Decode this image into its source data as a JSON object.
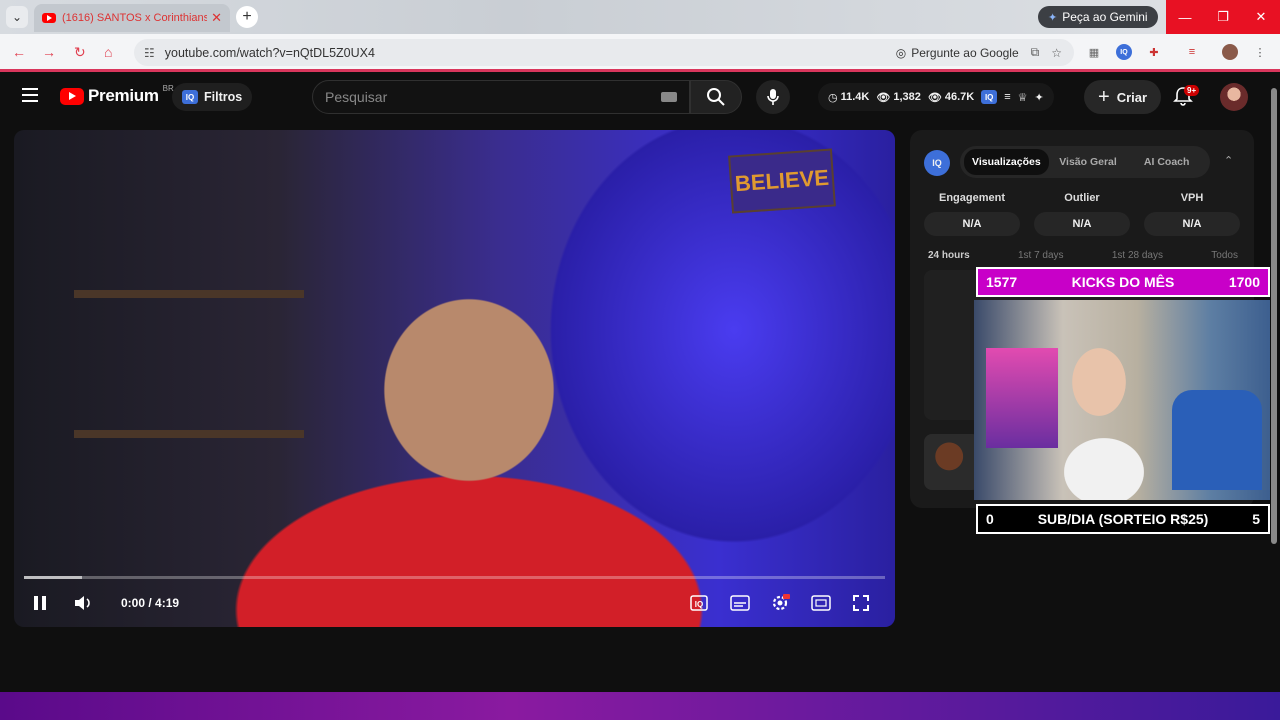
{
  "browser": {
    "tab_title": "(1616) SANTOS x Corinthians:",
    "tab_close": "✕",
    "new_tab": "+",
    "gemini_label": "Peça ao Gemini",
    "url": "youtube.com/watch?v=nQtDL5Z0UX4",
    "ask_google": "Pergunte ao Google",
    "win_min": "—",
    "win_max": "❐",
    "win_close": "✕"
  },
  "yt": {
    "logo_word": "Premium",
    "region": "BR",
    "filtros": "Filtros",
    "search_placeholder": "Pesquisar",
    "stats": {
      "a": "11.4K",
      "b": "1,382",
      "c": "46.7K"
    },
    "criar": "Criar",
    "notif_badge": "9+"
  },
  "player": {
    "sign_text": "BELIEVE",
    "time": "0:00 / 4:19",
    "progress_played": 0
  },
  "panel": {
    "iq": "IQ",
    "tabs": [
      "Visualizações",
      "Visão Geral",
      "AI Coach"
    ],
    "metrics": [
      {
        "label": "Engagement",
        "value": "N/A"
      },
      {
        "label": "Outlier",
        "value": "N/A"
      },
      {
        "label": "VPH",
        "value": "N/A"
      }
    ],
    "periods": [
      "24 hours",
      "1st 7 days",
      "1st 28 days",
      "Todos"
    ]
  },
  "overlay": {
    "kicks_left": "1577",
    "kicks_title": "KICKS DO MÊS",
    "kicks_right": "1700",
    "sub_left": "0",
    "sub_title": "SUB/DIA (SORTEIO R$25)",
    "sub_right": "5"
  },
  "colors": {
    "accent_red": "#ff0000",
    "iq_blue": "#3d6fd9",
    "kicks_magenta": "#c800c8"
  }
}
